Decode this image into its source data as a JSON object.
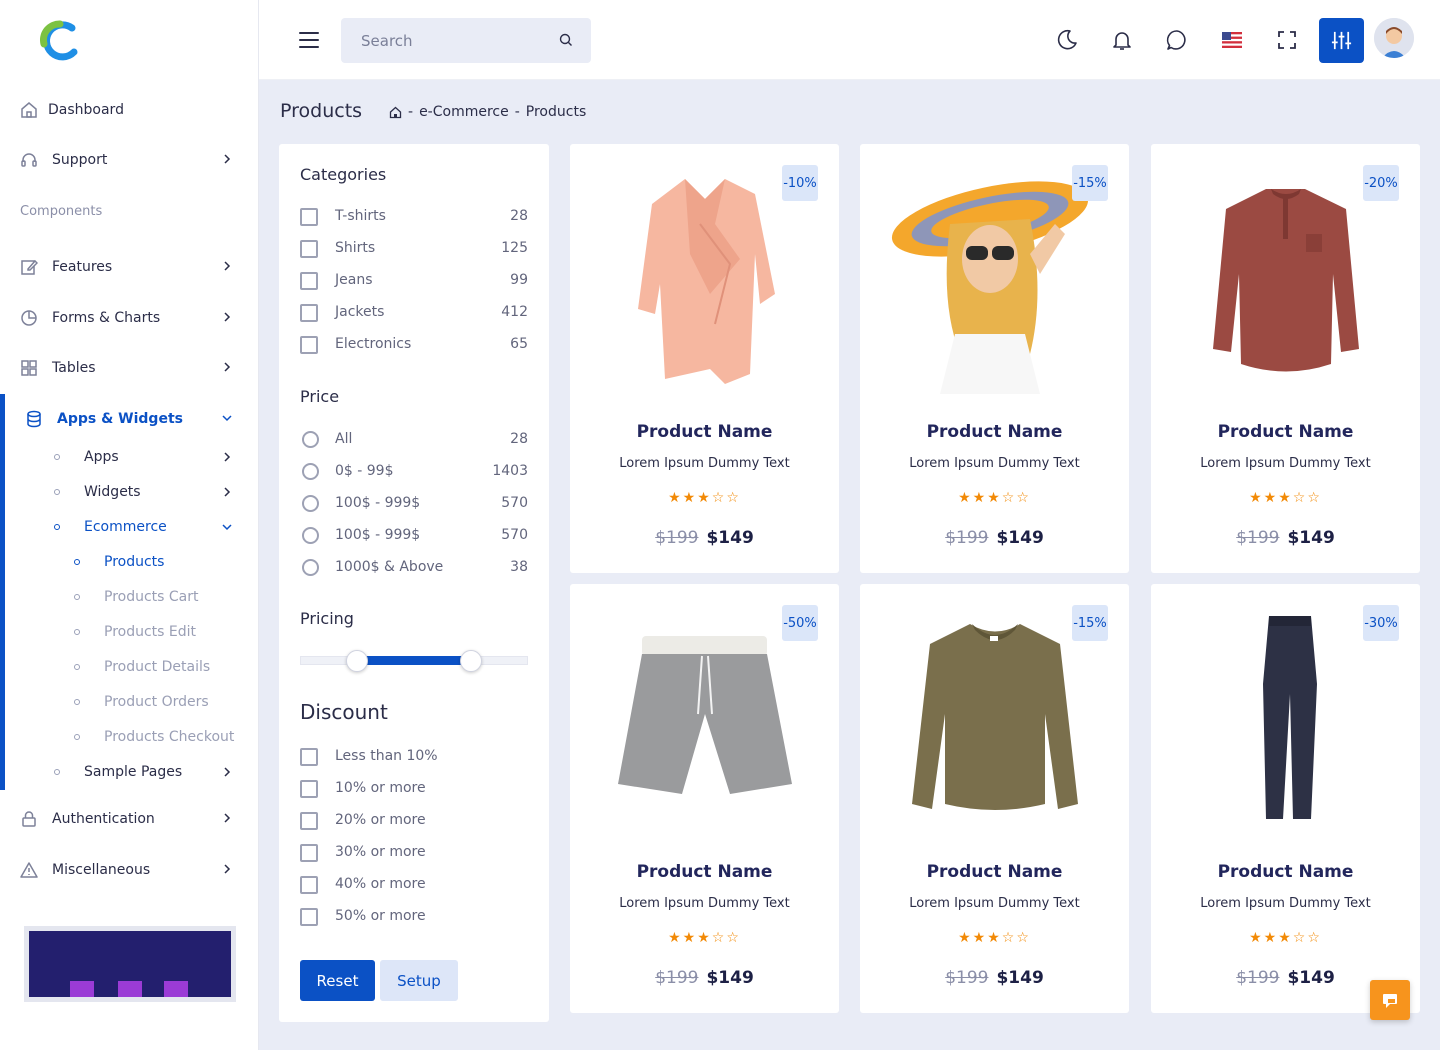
{
  "sidebar": {
    "items": [
      {
        "label": "Dashboard"
      },
      {
        "label": "Support"
      },
      {
        "label": "Features"
      },
      {
        "label": "Forms & Charts"
      },
      {
        "label": "Tables"
      },
      {
        "label": "Apps & Widgets"
      },
      {
        "label": "Authentication"
      },
      {
        "label": "Miscellaneous"
      }
    ],
    "section_label": "Components",
    "subitems": [
      {
        "label": "Apps"
      },
      {
        "label": "Widgets"
      },
      {
        "label": "Ecommerce"
      },
      {
        "label": "Products"
      },
      {
        "label": "Products Cart"
      },
      {
        "label": "Products Edit"
      },
      {
        "label": "Product Details"
      },
      {
        "label": "Product Orders"
      },
      {
        "label": "Products Checkout"
      },
      {
        "label": "Sample Pages"
      }
    ]
  },
  "header": {
    "search_placeholder": "Search",
    "accent_color": "#0b51c5"
  },
  "page": {
    "title": "Products",
    "breadcrumb": [
      "e-Commerce",
      "Products"
    ],
    "breadcrumb_sep": "-"
  },
  "filters": {
    "categories_title": "Categories",
    "categories": [
      {
        "name": "T-shirts",
        "count": "28"
      },
      {
        "name": "Shirts",
        "count": "125"
      },
      {
        "name": "Jeans",
        "count": "99"
      },
      {
        "name": "Jackets",
        "count": "412"
      },
      {
        "name": "Electronics",
        "count": "65"
      }
    ],
    "price_title": "Price",
    "prices": [
      {
        "name": "All",
        "count": "28"
      },
      {
        "name": "0$ - 99$",
        "count": "1403"
      },
      {
        "name": "100$ - 999$",
        "count": "570"
      },
      {
        "name": "100$ - 999$",
        "count": "570"
      },
      {
        "name": "1000$ & Above",
        "count": "38"
      }
    ],
    "pricing_title": "Pricing",
    "pricing_range": [
      0.25,
      0.75
    ],
    "discount_title": "Discount",
    "discounts": [
      "Less than 10%",
      "10% or more",
      "20% or more",
      "30% or more",
      "40% or more",
      "50% or more"
    ],
    "reset_label": "Reset",
    "setup_label": "Setup"
  },
  "products": [
    {
      "name": "Product Name",
      "desc": "Lorem Ipsum Dummy Text",
      "discount": "-10%",
      "old_price": "$199",
      "price": "$149",
      "rating": 3,
      "image": "pink-shirt"
    },
    {
      "name": "Product Name",
      "desc": "Lorem Ipsum Dummy Text",
      "discount": "-15%",
      "old_price": "$199",
      "price": "$149",
      "rating": 3,
      "image": "woman-hat"
    },
    {
      "name": "Product Name",
      "desc": "Lorem Ipsum Dummy Text",
      "discount": "-20%",
      "old_price": "$199",
      "price": "$149",
      "rating": 3,
      "image": "maroon-shirt"
    },
    {
      "name": "Product Name",
      "desc": "Lorem Ipsum Dummy Text",
      "discount": "-50%",
      "old_price": "$199",
      "price": "$149",
      "rating": 3,
      "image": "grey-shorts"
    },
    {
      "name": "Product Name",
      "desc": "Lorem Ipsum Dummy Text",
      "discount": "-15%",
      "old_price": "$199",
      "price": "$149",
      "rating": 3,
      "image": "olive-sweatshirt"
    },
    {
      "name": "Product Name",
      "desc": "Lorem Ipsum Dummy Text",
      "discount": "-30%",
      "old_price": "$199",
      "price": "$149",
      "rating": 3,
      "image": "navy-jeans"
    }
  ],
  "star_glyphs": {
    "full": "★",
    "empty": "☆"
  }
}
